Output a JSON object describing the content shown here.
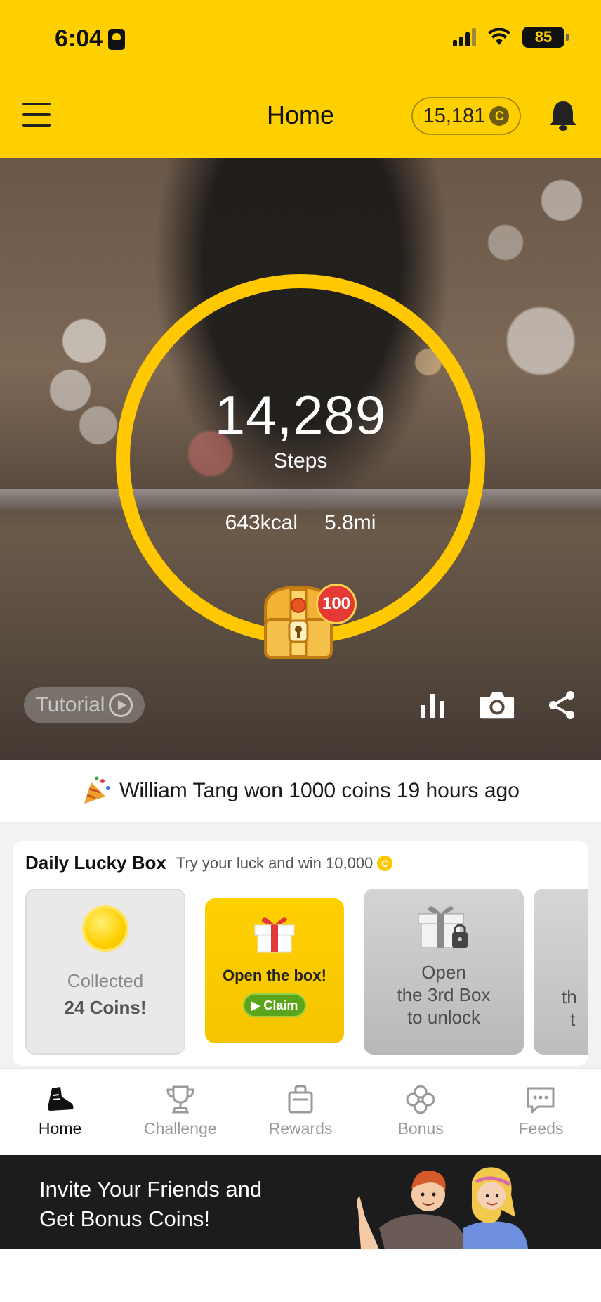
{
  "status": {
    "time": "6:04",
    "battery": "85"
  },
  "header": {
    "title": "Home",
    "coins": "15,181",
    "coin_symbol": "C"
  },
  "hero": {
    "steps": "14,289",
    "steps_label": "Steps",
    "kcal": "643kcal",
    "distance": "5.8mi",
    "chest_badge": "100",
    "tutorial_label": "Tutorial"
  },
  "ticker": {
    "text": "William Tang won 1000 coins 19 hours ago"
  },
  "lucky": {
    "title": "Daily Lucky Box",
    "subtitle": "Try your luck and win 10,000",
    "coin_symbol": "C",
    "collected_line1": "Collected",
    "collected_line2": "24 Coins!",
    "open_label": "Open the box!",
    "claim_label": "Claim",
    "locked_line1": "Open",
    "locked_line2": "the 3rd Box",
    "locked_line3": "to unlock",
    "peek_line1": "th",
    "peek_line2": "t"
  },
  "tabs": [
    {
      "label": "Home",
      "icon": "shoe-icon"
    },
    {
      "label": "Challenge",
      "icon": "trophy-icon"
    },
    {
      "label": "Rewards",
      "icon": "shopping-bag-icon"
    },
    {
      "label": "Bonus",
      "icon": "clover-icon"
    },
    {
      "label": "Feeds",
      "icon": "chat-bubble-icon"
    }
  ],
  "banner": {
    "line1": "Invite Your Friends and",
    "line2": "Get Bonus Coins!"
  },
  "colors": {
    "brand_yellow": "#FFD000",
    "ring": "#FFC800",
    "claim_green": "#5aa51b",
    "badge_red": "#e53935"
  }
}
